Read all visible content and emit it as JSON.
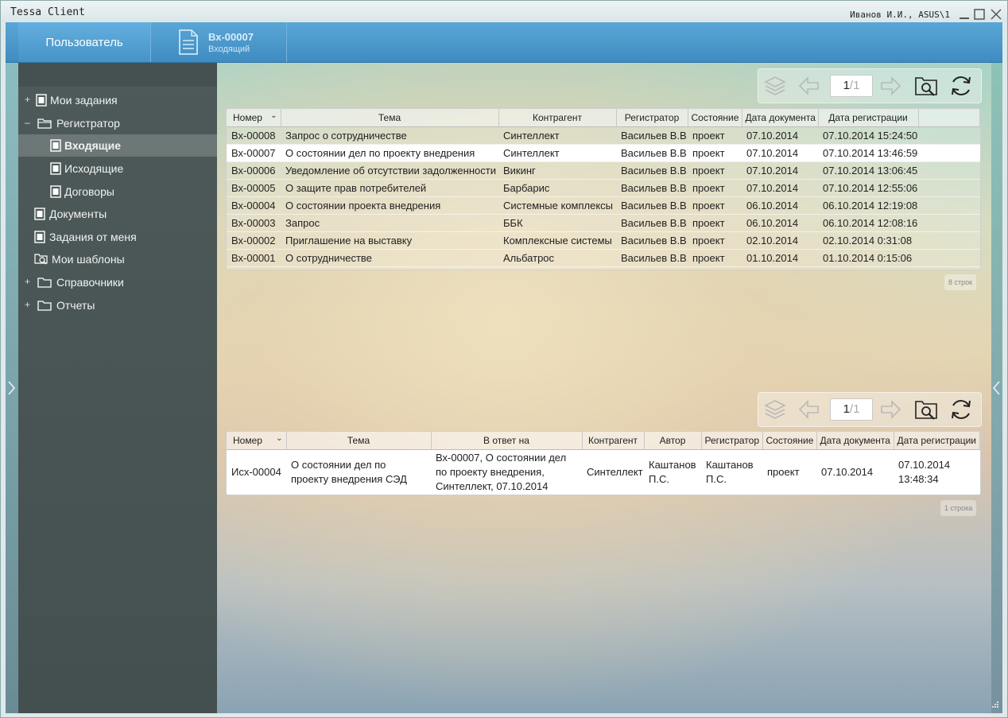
{
  "window": {
    "title": "Tessa Client",
    "user": "Иванов И.И., ASUS\\1"
  },
  "tabs": {
    "user_tab": "Пользователь",
    "doc_number": "Вх-00007",
    "doc_type": "Входящий"
  },
  "sidebar": {
    "items": [
      {
        "label": "Мои задания",
        "expander": "+"
      },
      {
        "label": "Регистратор",
        "expander": "–"
      },
      {
        "label": "Входящие"
      },
      {
        "label": "Исходящие"
      },
      {
        "label": "Договоры"
      },
      {
        "label": "Документы"
      },
      {
        "label": "Задания от меня"
      },
      {
        "label": "Мои шаблоны"
      },
      {
        "label": "Справочники",
        "expander": "+"
      },
      {
        "label": "Отчеты",
        "expander": "+"
      }
    ]
  },
  "pager_top": {
    "page": "1",
    "sep": "/",
    "total": "1"
  },
  "pager_bottom": {
    "page": "1",
    "sep": "/",
    "total": "1"
  },
  "table_top": {
    "headers": [
      "Номер",
      "Тема",
      "Контрагент",
      "Регистратор",
      "Состояние",
      "Дата документа",
      "Дата регистрации"
    ],
    "rows": [
      [
        "Вх-00008",
        "Запрос о сотрудничестве",
        "Синтеллект",
        "Васильев В.В.",
        "проект",
        "07.10.2014",
        "07.10.2014 15:24:50"
      ],
      [
        "Вх-00007",
        "О состоянии дел по проекту внедрения",
        "Синтеллект",
        "Васильев В.В.",
        "проект",
        "07.10.2014",
        "07.10.2014 13:46:59"
      ],
      [
        "Вх-00006",
        "Уведомление об отсутствии задолженности",
        "Викинг",
        "Васильев В.В.",
        "проект",
        "07.10.2014",
        "07.10.2014 13:06:45"
      ],
      [
        "Вх-00005",
        "О защите прав потребителей",
        "Барбарис",
        "Васильев В.В.",
        "проект",
        "07.10.2014",
        "07.10.2014 12:55:06"
      ],
      [
        "Вх-00004",
        "О состоянии проекта внедрения",
        "Системные комплексы",
        "Васильев В.В.",
        "проект",
        "06.10.2014",
        "06.10.2014 12:19:08"
      ],
      [
        "Вх-00003",
        "Запрос",
        "ББК",
        "Васильев В.В.",
        "проект",
        "06.10.2014",
        "06.10.2014 12:08:16"
      ],
      [
        "Вх-00002",
        "Приглашение на выставку",
        "Комплексные системы",
        "Васильев В.В.",
        "проект",
        "02.10.2014",
        "02.10.2014 0:31:08"
      ],
      [
        "Вх-00001",
        "О сотрудничестве",
        "Альбатрос",
        "Васильев В.В.",
        "проект",
        "01.10.2014",
        "01.10.2014 0:15:06"
      ]
    ],
    "count": "8 строк"
  },
  "table_bottom": {
    "headers": [
      "Номер",
      "Тема",
      "В ответ на",
      "Контрагент",
      "Автор",
      "Регистратор",
      "Состояние",
      "Дата документа",
      "Дата регистрации"
    ],
    "rows": [
      [
        "Исх-00004",
        "О состоянии дел по проекту внедрения СЭД",
        "Вх-00007, О состоянии дел по проекту внедрения, Синтеллект, 07.10.2014",
        "Синтеллект",
        "Каштанов П.С.",
        "Каштанов П.С.",
        "проект",
        "07.10.2014",
        "07.10.2014 13:48:34"
      ]
    ],
    "count": "1 строка"
  }
}
